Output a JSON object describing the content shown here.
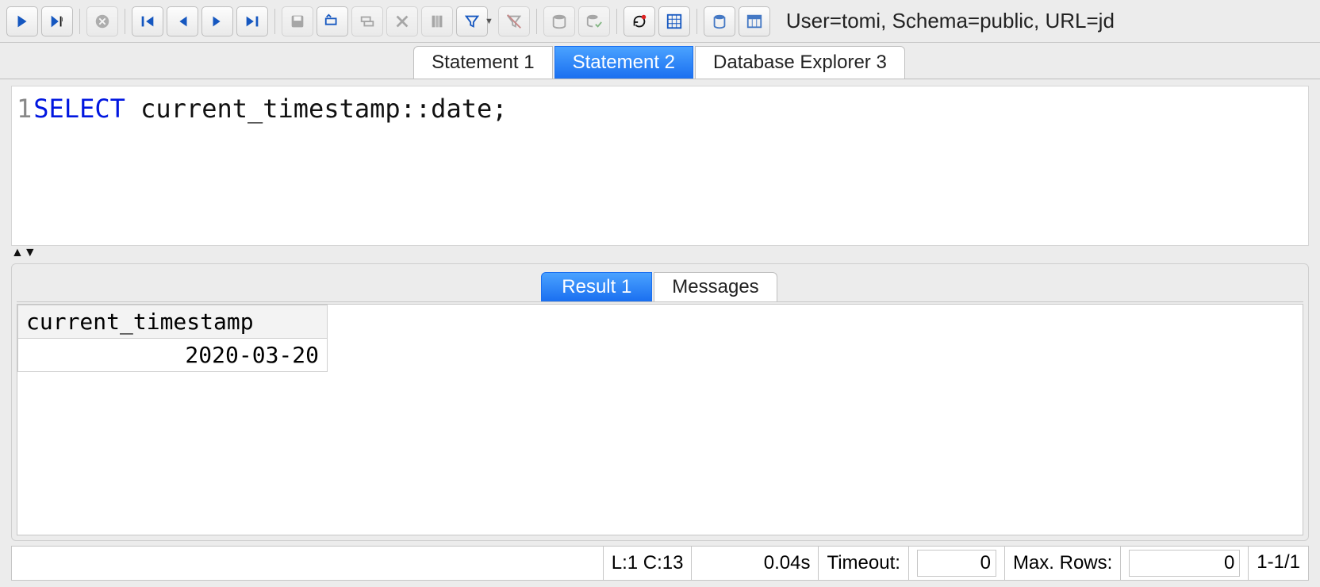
{
  "toolbar": {
    "icons": {
      "run": "play-icon",
      "run_to_cursor": "play-cursor-icon",
      "stop": "stop-icon",
      "first": "first-record-icon",
      "prev": "prev-record-icon",
      "next": "next-record-icon",
      "last": "last-record-icon",
      "save": "save-icon",
      "insert_row": "insert-row-icon",
      "duplicate_row": "duplicate-row-icon",
      "delete_row": "delete-row-icon",
      "columns": "columns-icon",
      "filter": "filter-icon",
      "clear_filter": "clear-filter-icon",
      "db": "database-icon",
      "db_commit": "database-commit-icon",
      "refresh": "refresh-icon",
      "grid": "grid-icon",
      "schema_browser": "schema-browser-icon",
      "table_editor": "table-editor-icon"
    },
    "connection_info": "User=tomi, Schema=public, URL=jd"
  },
  "tabs": [
    {
      "label": "Statement 1",
      "active": false
    },
    {
      "label": "Statement 2",
      "active": true
    },
    {
      "label": "Database Explorer 3",
      "active": false
    }
  ],
  "editor": {
    "line_number": "1",
    "keyword": "SELECT",
    "rest": " current_timestamp::date;"
  },
  "result_tabs": [
    {
      "label": "Result 1",
      "active": true
    },
    {
      "label": "Messages",
      "active": false
    }
  ],
  "result": {
    "columns": [
      "current_timestamp"
    ],
    "rows": [
      [
        "2020-03-20"
      ]
    ]
  },
  "status": {
    "caret": "L:1 C:13",
    "elapsed": "0.04s",
    "timeout_label": "Timeout:",
    "timeout_value": "0",
    "maxrows_label": "Max. Rows:",
    "maxrows_value": "0",
    "row_range": "1-1/1"
  }
}
